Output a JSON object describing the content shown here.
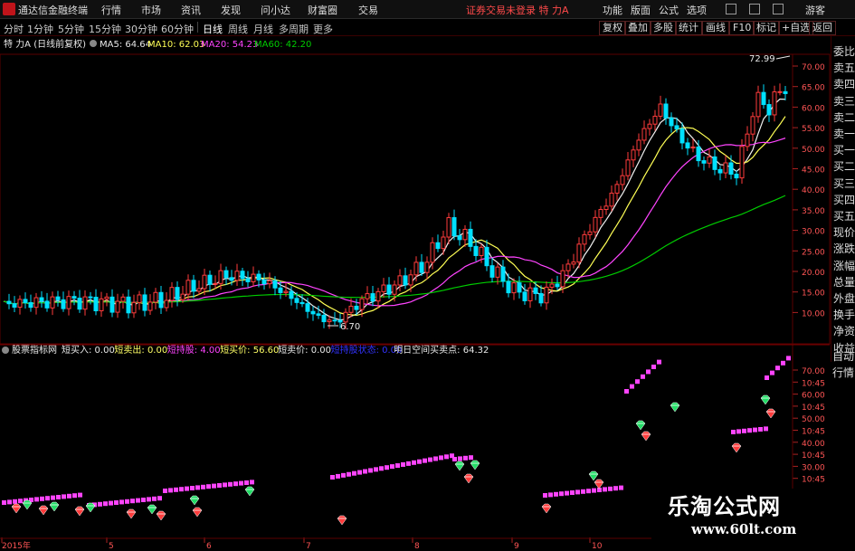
{
  "menubar": {
    "app_title": "通达信金融终端",
    "items": [
      "行情",
      "市场",
      "资讯",
      "发现",
      "问小达",
      "财富圈",
      "交易"
    ],
    "stock_title": "证券交易未登录 特 力A",
    "right_items": [
      "功能",
      "版面",
      "公式",
      "选项",
      "游客"
    ]
  },
  "periods": {
    "items": [
      "分时",
      "1分钟",
      "5分钟",
      "15分钟",
      "30分钟",
      "60分钟",
      "日线",
      "周线",
      "月线",
      "多周期",
      "更多"
    ],
    "active": "日线",
    "tools": [
      "复权",
      "叠加",
      "多股",
      "统计",
      "画线",
      "F10",
      "标记",
      "+自选",
      "返回"
    ]
  },
  "main_legend": {
    "title": "特 力A (日线前复权)",
    "ma5": "MA5: 64.64",
    "ma10": "MA10: 62.03",
    "ma20": "MA20: 54.23",
    "ma60": "MA60: 42.20"
  },
  "sub_legend": {
    "name": "股票指标网",
    "items": [
      {
        "text": "短买入: 0.00",
        "color": "#e8e8e8"
      },
      {
        "text": "短卖出: 0.00",
        "color": "#ffff66"
      },
      {
        "text": "短持股: 4.00",
        "color": "#ff44ff"
      },
      {
        "text": "短买价: 56.60",
        "color": "#ffff66"
      },
      {
        "text": "短卖价: 0.00",
        "color": "#e8e8e8"
      },
      {
        "text": "短持股状态: 0.00",
        "color": "#3333ff"
      },
      {
        "text": "明日空间买卖点: 64.32",
        "color": "#e8e8e8"
      }
    ]
  },
  "price_axis": [
    "70.00",
    "65.00",
    "60.00",
    "55.00",
    "50.00",
    "45.00",
    "40.00",
    "35.00",
    "30.00",
    "25.00",
    "20.00",
    "15.00",
    "10.00"
  ],
  "sub_axis": [
    "70.00",
    "10:45",
    "60.00",
    "10:45",
    "50.00",
    "10:45",
    "40.00",
    "10:45",
    "30.00",
    "10:45"
  ],
  "right_panel": [
    "委比",
    "卖五",
    "卖四",
    "卖三",
    "卖二",
    "卖一",
    "买一",
    "买二",
    "买三",
    "买四",
    "买五",
    "现价",
    "涨跌",
    "涨幅",
    "总量",
    "外盘",
    "换手",
    "净资",
    "收益"
  ],
  "right_panel2": [
    "自动",
    "行情"
  ],
  "annotations": {
    "high": "72.99",
    "low": "6.70"
  },
  "x_axis": [
    "2015年",
    "5",
    "6",
    "7",
    "8",
    "9",
    "10"
  ],
  "watermark": {
    "line1": "乐淘公式网",
    "line2": "www.60lt.com"
  },
  "colors": {
    "up": "#ff3c3c",
    "down": "#00e0ff",
    "ma5": "#f0f0f0",
    "ma10": "#ffff55",
    "ma20": "#ff44ff",
    "ma60": "#00cc00",
    "grid": "#5a0000"
  }
}
